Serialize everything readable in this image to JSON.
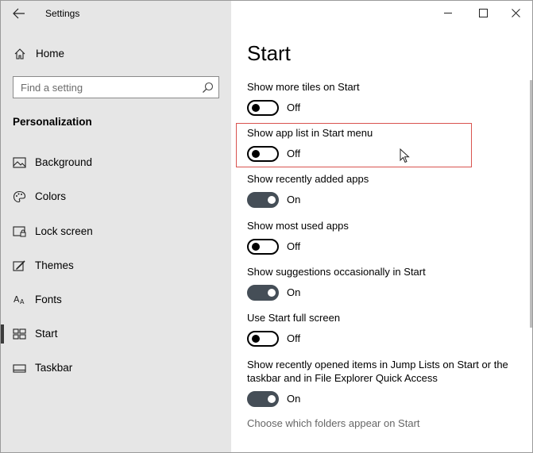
{
  "titlebar": {
    "title": "Settings"
  },
  "sidebar": {
    "home_label": "Home",
    "search_placeholder": "Find a setting",
    "section_title": "Personalization",
    "items": [
      {
        "label": "Background",
        "icon": "picture-icon"
      },
      {
        "label": "Colors",
        "icon": "palette-icon"
      },
      {
        "label": "Lock screen",
        "icon": "lock-screen-icon"
      },
      {
        "label": "Themes",
        "icon": "themes-icon"
      },
      {
        "label": "Fonts",
        "icon": "fonts-icon"
      },
      {
        "label": "Start",
        "icon": "start-icon",
        "selected": true
      },
      {
        "label": "Taskbar",
        "icon": "taskbar-icon"
      }
    ]
  },
  "main": {
    "title": "Start",
    "settings": [
      {
        "label": "Show more tiles on Start",
        "state": "Off",
        "on": false
      },
      {
        "label": "Show app list in Start menu",
        "state": "Off",
        "on": false
      },
      {
        "label": "Show recently added apps",
        "state": "On",
        "on": true
      },
      {
        "label": "Show most used apps",
        "state": "Off",
        "on": false
      },
      {
        "label": "Show suggestions occasionally in Start",
        "state": "On",
        "on": true
      },
      {
        "label": "Use Start full screen",
        "state": "Off",
        "on": false
      },
      {
        "label": "Show recently opened items in Jump Lists on Start or the taskbar and in File Explorer Quick Access",
        "state": "On",
        "on": true
      }
    ],
    "link": "Choose which folders appear on Start"
  },
  "colors": {
    "sidebar_bg": "#e6e6e6",
    "toggle_on": "#454e57",
    "highlight": "#d9534f"
  }
}
